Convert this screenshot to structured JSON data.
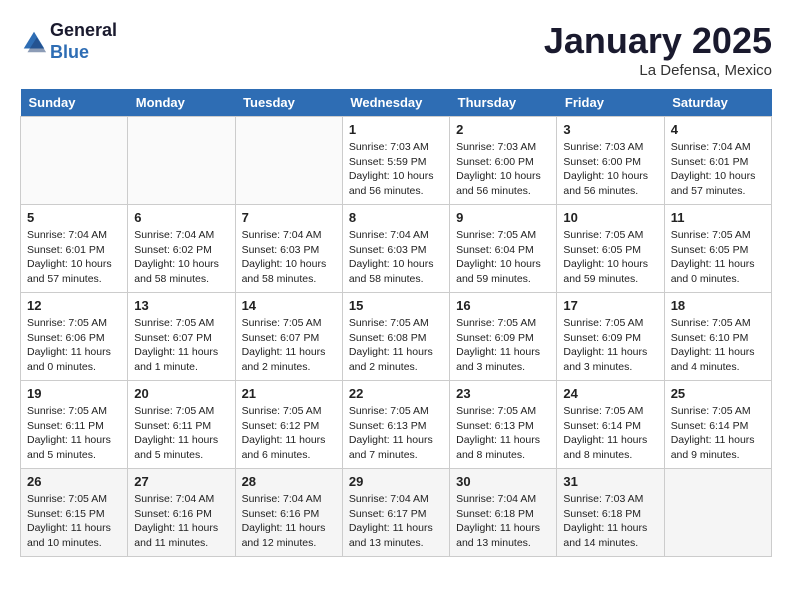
{
  "logo": {
    "line1": "General",
    "line2": "Blue"
  },
  "title": "January 2025",
  "location": "La Defensa, Mexico",
  "weekdays": [
    "Sunday",
    "Monday",
    "Tuesday",
    "Wednesday",
    "Thursday",
    "Friday",
    "Saturday"
  ],
  "days": [
    {
      "num": "",
      "info": ""
    },
    {
      "num": "",
      "info": ""
    },
    {
      "num": "",
      "info": ""
    },
    {
      "num": "1",
      "info": "Sunrise: 7:03 AM\nSunset: 5:59 PM\nDaylight: 10 hours\nand 56 minutes."
    },
    {
      "num": "2",
      "info": "Sunrise: 7:03 AM\nSunset: 6:00 PM\nDaylight: 10 hours\nand 56 minutes."
    },
    {
      "num": "3",
      "info": "Sunrise: 7:03 AM\nSunset: 6:00 PM\nDaylight: 10 hours\nand 56 minutes."
    },
    {
      "num": "4",
      "info": "Sunrise: 7:04 AM\nSunset: 6:01 PM\nDaylight: 10 hours\nand 57 minutes."
    },
    {
      "num": "5",
      "info": "Sunrise: 7:04 AM\nSunset: 6:01 PM\nDaylight: 10 hours\nand 57 minutes."
    },
    {
      "num": "6",
      "info": "Sunrise: 7:04 AM\nSunset: 6:02 PM\nDaylight: 10 hours\nand 58 minutes."
    },
    {
      "num": "7",
      "info": "Sunrise: 7:04 AM\nSunset: 6:03 PM\nDaylight: 10 hours\nand 58 minutes."
    },
    {
      "num": "8",
      "info": "Sunrise: 7:04 AM\nSunset: 6:03 PM\nDaylight: 10 hours\nand 58 minutes."
    },
    {
      "num": "9",
      "info": "Sunrise: 7:05 AM\nSunset: 6:04 PM\nDaylight: 10 hours\nand 59 minutes."
    },
    {
      "num": "10",
      "info": "Sunrise: 7:05 AM\nSunset: 6:05 PM\nDaylight: 10 hours\nand 59 minutes."
    },
    {
      "num": "11",
      "info": "Sunrise: 7:05 AM\nSunset: 6:05 PM\nDaylight: 11 hours\nand 0 minutes."
    },
    {
      "num": "12",
      "info": "Sunrise: 7:05 AM\nSunset: 6:06 PM\nDaylight: 11 hours\nand 0 minutes."
    },
    {
      "num": "13",
      "info": "Sunrise: 7:05 AM\nSunset: 6:07 PM\nDaylight: 11 hours\nand 1 minute."
    },
    {
      "num": "14",
      "info": "Sunrise: 7:05 AM\nSunset: 6:07 PM\nDaylight: 11 hours\nand 2 minutes."
    },
    {
      "num": "15",
      "info": "Sunrise: 7:05 AM\nSunset: 6:08 PM\nDaylight: 11 hours\nand 2 minutes."
    },
    {
      "num": "16",
      "info": "Sunrise: 7:05 AM\nSunset: 6:09 PM\nDaylight: 11 hours\nand 3 minutes."
    },
    {
      "num": "17",
      "info": "Sunrise: 7:05 AM\nSunset: 6:09 PM\nDaylight: 11 hours\nand 3 minutes."
    },
    {
      "num": "18",
      "info": "Sunrise: 7:05 AM\nSunset: 6:10 PM\nDaylight: 11 hours\nand 4 minutes."
    },
    {
      "num": "19",
      "info": "Sunrise: 7:05 AM\nSunset: 6:11 PM\nDaylight: 11 hours\nand 5 minutes."
    },
    {
      "num": "20",
      "info": "Sunrise: 7:05 AM\nSunset: 6:11 PM\nDaylight: 11 hours\nand 5 minutes."
    },
    {
      "num": "21",
      "info": "Sunrise: 7:05 AM\nSunset: 6:12 PM\nDaylight: 11 hours\nand 6 minutes."
    },
    {
      "num": "22",
      "info": "Sunrise: 7:05 AM\nSunset: 6:13 PM\nDaylight: 11 hours\nand 7 minutes."
    },
    {
      "num": "23",
      "info": "Sunrise: 7:05 AM\nSunset: 6:13 PM\nDaylight: 11 hours\nand 8 minutes."
    },
    {
      "num": "24",
      "info": "Sunrise: 7:05 AM\nSunset: 6:14 PM\nDaylight: 11 hours\nand 8 minutes."
    },
    {
      "num": "25",
      "info": "Sunrise: 7:05 AM\nSunset: 6:14 PM\nDaylight: 11 hours\nand 9 minutes."
    },
    {
      "num": "26",
      "info": "Sunrise: 7:05 AM\nSunset: 6:15 PM\nDaylight: 11 hours\nand 10 minutes."
    },
    {
      "num": "27",
      "info": "Sunrise: 7:04 AM\nSunset: 6:16 PM\nDaylight: 11 hours\nand 11 minutes."
    },
    {
      "num": "28",
      "info": "Sunrise: 7:04 AM\nSunset: 6:16 PM\nDaylight: 11 hours\nand 12 minutes."
    },
    {
      "num": "29",
      "info": "Sunrise: 7:04 AM\nSunset: 6:17 PM\nDaylight: 11 hours\nand 13 minutes."
    },
    {
      "num": "30",
      "info": "Sunrise: 7:04 AM\nSunset: 6:18 PM\nDaylight: 11 hours\nand 13 minutes."
    },
    {
      "num": "31",
      "info": "Sunrise: 7:03 AM\nSunset: 6:18 PM\nDaylight: 11 hours\nand 14 minutes."
    },
    {
      "num": "",
      "info": ""
    }
  ]
}
